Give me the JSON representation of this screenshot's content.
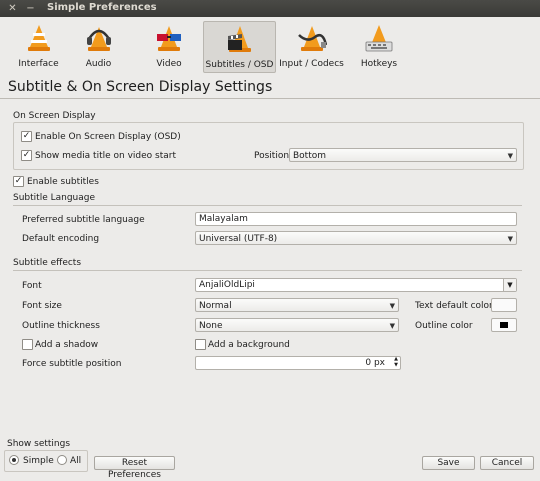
{
  "window": {
    "title": "Simple Preferences",
    "close_glyph": "✕",
    "minimize_glyph": "−"
  },
  "tabs": [
    {
      "label": "Interface",
      "icon": "vlc-cone-icon"
    },
    {
      "label": "Audio",
      "icon": "headphones-cone-icon"
    },
    {
      "label": "Video",
      "icon": "glasses-cone-icon"
    },
    {
      "label": "Subtitles / OSD",
      "icon": "clapper-cone-icon",
      "active": true
    },
    {
      "label": "Input / Codecs",
      "icon": "cable-cone-icon"
    },
    {
      "label": "Hotkeys",
      "icon": "keyboard-cone-icon"
    }
  ],
  "page_title": "Subtitle & On Screen Display Settings",
  "osd": {
    "section_label": "On Screen Display",
    "enable_osd_label": "Enable On Screen Display (OSD)",
    "enable_osd_checked": true,
    "show_title_label": "Show media title on video start",
    "show_title_checked": true,
    "position_label": "Position",
    "position_value": "Bottom"
  },
  "enable_subtitles": {
    "label": "Enable subtitles",
    "checked": true
  },
  "language": {
    "section_label": "Subtitle Language",
    "preferred_label": "Preferred subtitle language",
    "preferred_value": "Malayalam",
    "encoding_label": "Default encoding",
    "encoding_value": "Universal (UTF-8)"
  },
  "effects": {
    "section_label": "Subtitle effects",
    "font_label": "Font",
    "font_value": "AnjaliOldLipi",
    "font_size_label": "Font size",
    "font_size_value": "Normal",
    "text_color_label": "Text default color",
    "outline_thickness_label": "Outline thickness",
    "outline_thickness_value": "None",
    "outline_color_label": "Outline color",
    "shadow_label": "Add a shadow",
    "shadow_checked": false,
    "background_label": "Add a background",
    "background_checked": false,
    "force_position_label": "Force subtitle position",
    "force_position_value": "0 px"
  },
  "footer": {
    "show_settings_label": "Show settings",
    "simple_label": "Simple",
    "simple_selected": true,
    "all_label": "All",
    "reset_label": "Reset Preferences",
    "save_label": "Save",
    "cancel_label": "Cancel"
  },
  "colors": {
    "titlebar": "#3f3f3c",
    "window_bg": "#ecebe9",
    "text_default_color": "#fafafa",
    "outline_color": "#000000",
    "cone_orange": "#f29b1d"
  }
}
